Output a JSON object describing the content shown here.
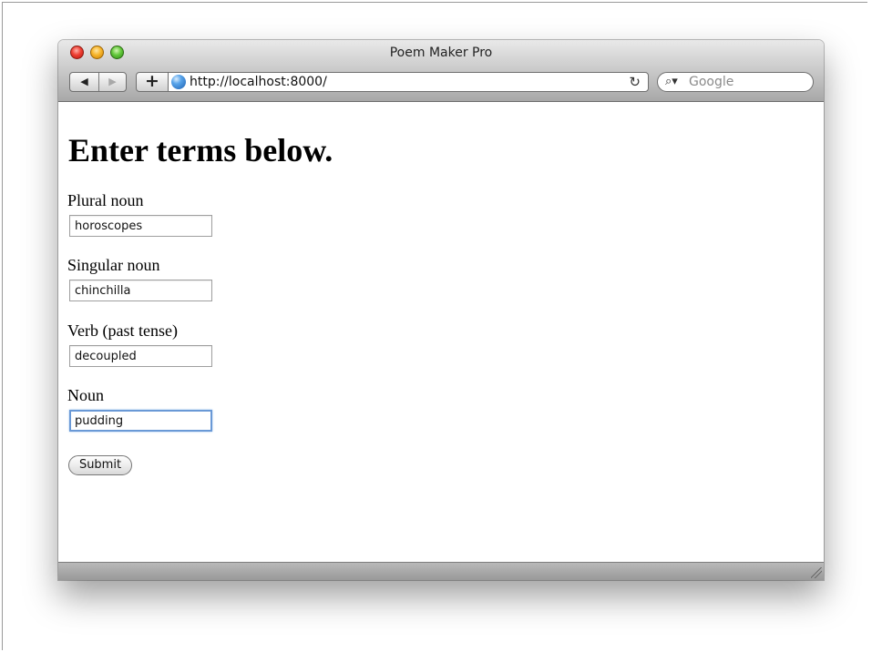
{
  "window": {
    "title": "Poem Maker Pro"
  },
  "toolbar": {
    "back_label": "◀",
    "forward_label": "▶",
    "add_label": "+",
    "address": "http://localhost:8000/",
    "reload_label": "↻",
    "search_placeholder": "Google",
    "search_icon_label": "⌕▾"
  },
  "page": {
    "heading": "Enter terms below.",
    "fields": [
      {
        "label": "Plural noun",
        "value": "horoscopes"
      },
      {
        "label": "Singular noun",
        "value": "chinchilla"
      },
      {
        "label": "Verb (past tense)",
        "value": "decoupled"
      },
      {
        "label": "Noun",
        "value": "pudding"
      }
    ],
    "submit_label": "Submit"
  }
}
